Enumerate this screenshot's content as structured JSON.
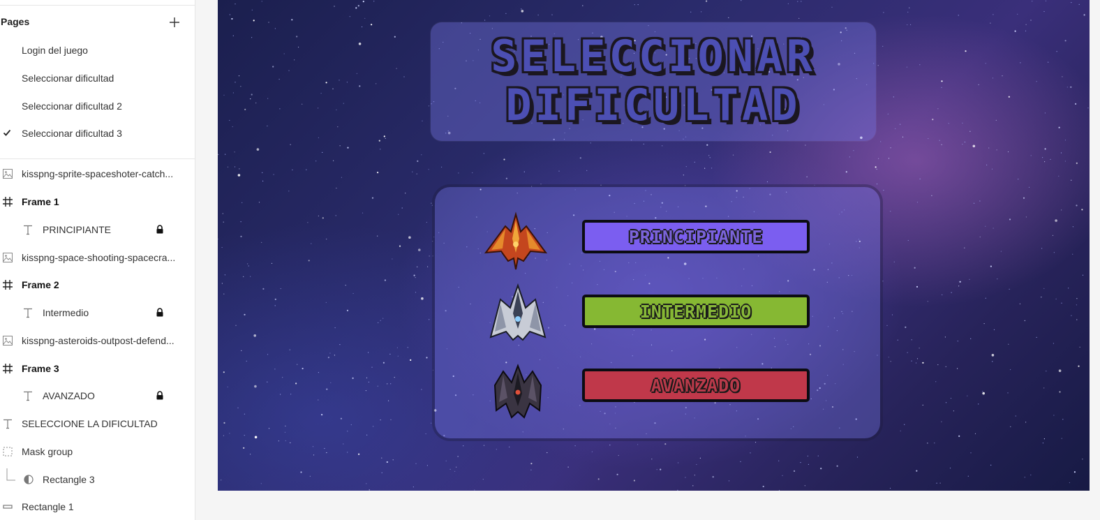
{
  "sidebar": {
    "pages_title": "Pages",
    "pages": [
      {
        "label": "Login del juego",
        "current": false
      },
      {
        "label": "Seleccionar dificultad",
        "current": false
      },
      {
        "label": "Seleccionar dificultad 2",
        "current": false
      },
      {
        "label": "Seleccionar dificultad 3",
        "current": true
      }
    ],
    "layers": [
      {
        "label": "kisspng-sprite-spaceshoter-catch...",
        "icon": "image-icon",
        "bold": false,
        "indent": 0,
        "locked": false
      },
      {
        "label": "Frame 1",
        "icon": "frame-icon",
        "bold": true,
        "indent": 0,
        "locked": false
      },
      {
        "label": "PRINCIPIANTE",
        "icon": "text-icon",
        "bold": false,
        "indent": 1,
        "locked": true
      },
      {
        "label": "kisspng-space-shooting-spacecra...",
        "icon": "image-icon",
        "bold": false,
        "indent": 0,
        "locked": false
      },
      {
        "label": "Frame 2",
        "icon": "frame-icon",
        "bold": true,
        "indent": 0,
        "locked": false
      },
      {
        "label": "Intermedio",
        "icon": "text-icon",
        "bold": false,
        "indent": 1,
        "locked": true
      },
      {
        "label": "kisspng-asteroids-outpost-defend...",
        "icon": "image-icon",
        "bold": false,
        "indent": 0,
        "locked": false
      },
      {
        "label": "Frame 3",
        "icon": "frame-icon",
        "bold": true,
        "indent": 0,
        "locked": false
      },
      {
        "label": "AVANZADO",
        "icon": "text-icon",
        "bold": false,
        "indent": 1,
        "locked": true
      },
      {
        "label": "SELECCIONE LA DIFICULTAD",
        "icon": "text-icon",
        "bold": false,
        "indent": 0,
        "locked": false
      },
      {
        "label": "Mask group",
        "icon": "mask-group-icon",
        "bold": false,
        "indent": 0,
        "locked": false
      },
      {
        "label": "Rectangle 3",
        "icon": "mask-icon",
        "bold": false,
        "indent": 1,
        "locked": false
      },
      {
        "label": "Rectangle 1",
        "icon": "rectangle-icon",
        "bold": false,
        "indent": 0,
        "locked": false
      }
    ]
  },
  "canvas": {
    "title_line1": "SELECCIONAR",
    "title_line2": "DIFICULTAD",
    "buttons": [
      {
        "label": "PRINCIPIANTE",
        "bg": "#7b5ef0",
        "fg": "#7a63d8",
        "ship": "red-ship-icon"
      },
      {
        "label": "INTERMEDIO",
        "bg": "#86b833",
        "fg": "#87b839",
        "ship": "silver-ship-icon"
      },
      {
        "label": "AVANZADO",
        "bg": "#c0384a",
        "fg": "#b83a4a",
        "ship": "dark-ship-icon"
      }
    ]
  },
  "colors": {
    "accent_text": "#333333",
    "divider": "#e6e6e6",
    "title_fill": "#4c4fb3",
    "outline": "#1b1720"
  }
}
